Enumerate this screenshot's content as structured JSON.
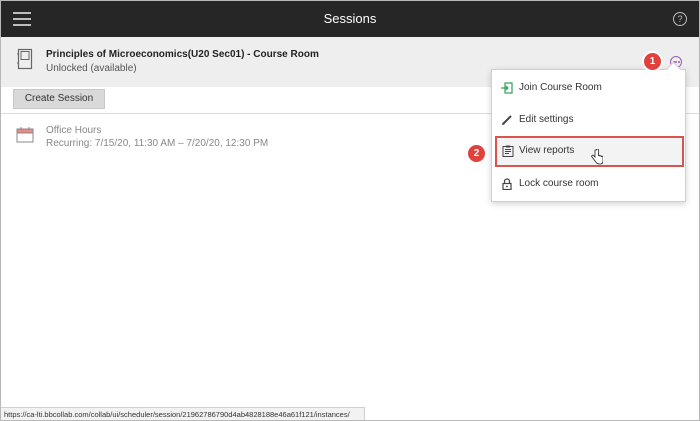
{
  "header": {
    "title": "Sessions"
  },
  "room": {
    "title": "Principles of Microeconomics(U20 Sec01) - Course Room",
    "status": "Unlocked (available)"
  },
  "toolbar": {
    "create_label": "Create Session"
  },
  "sessions": [
    {
      "name": "Office Hours",
      "time": "Recurring: 7/15/20, 11:30 AM – 7/20/20, 12:30 PM"
    }
  ],
  "menu": {
    "items": [
      {
        "label": "Join Course Room",
        "icon": "join-icon"
      },
      {
        "label": "Edit settings",
        "icon": "pencil-icon"
      },
      {
        "label": "View reports",
        "icon": "report-icon"
      },
      {
        "label": "Lock course room",
        "icon": "lock-icon"
      }
    ]
  },
  "callouts": {
    "first": "1",
    "second": "2"
  },
  "status_url": "https://ca-lti.bbcollab.com/collab/ui/scheduler/session/21962786790d4ab4828188e46a61f121/instances/",
  "colors": {
    "topbar": "#262626",
    "accent": "#9b59b6",
    "callout": "#e0413c"
  }
}
